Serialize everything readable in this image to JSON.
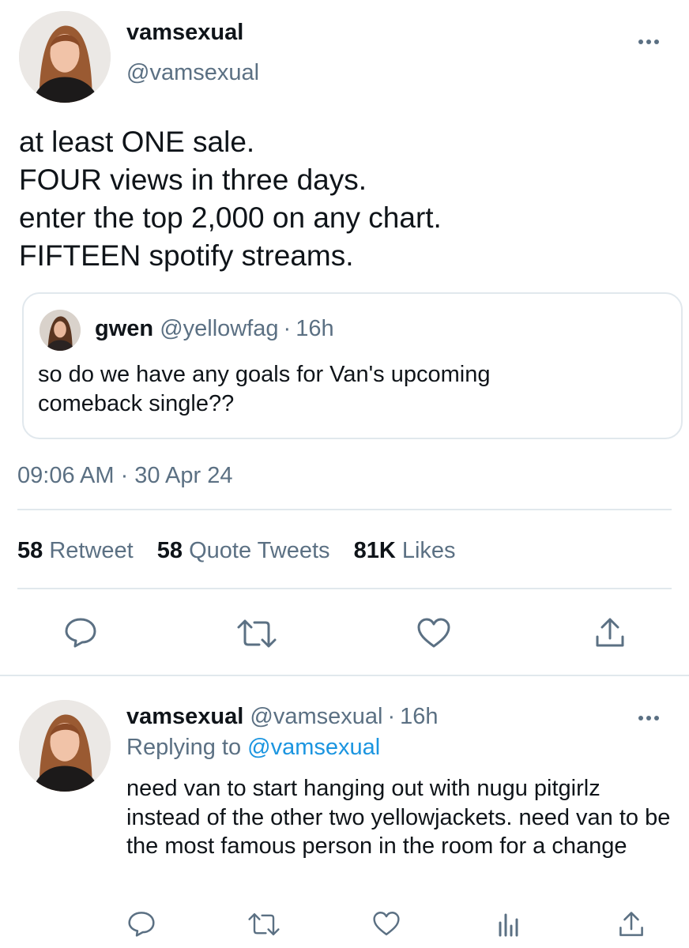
{
  "main_tweet": {
    "display_name": "vamsexual",
    "handle": "@vamsexual",
    "lines": [
      "at least ONE sale.",
      "FOUR views in three days.",
      "enter the top 2,000 on any chart.",
      "FIFTEEN spotify streams."
    ],
    "quoted": {
      "display_name": "gwen",
      "handle": "@yellowfag",
      "separator": "·",
      "time": "16h",
      "text": "so do we have any goals for Van's upcoming comeback single??"
    },
    "timestamp": "09:06 AM · 30 Apr 24",
    "stats": {
      "retweets_count": "58",
      "retweets_label": "Retweet",
      "quotes_count": "58",
      "quotes_label": "Quote Tweets",
      "likes_count": "81K",
      "likes_label": "Likes"
    }
  },
  "reply_tweet": {
    "display_name": "vamsexual",
    "handle": "@vamsexual",
    "separator": "·",
    "time": "16h",
    "replying_prefix": "Replying to",
    "replying_handle": "@vamsexual",
    "text": "need van to start hanging out with nugu pitgirlz instead of the other two yellowjackets. need van to be the most famous person in the room for a change"
  },
  "icons": {
    "more": "more-horizontal-icon",
    "reply": "reply-icon",
    "retweet": "retweet-icon",
    "like": "like-icon",
    "share": "share-icon",
    "analytics": "analytics-icon"
  },
  "colors": {
    "text": "#0f1419",
    "muted": "#5b7083",
    "link": "#1b95e0",
    "divider": "#e1e8ed"
  }
}
